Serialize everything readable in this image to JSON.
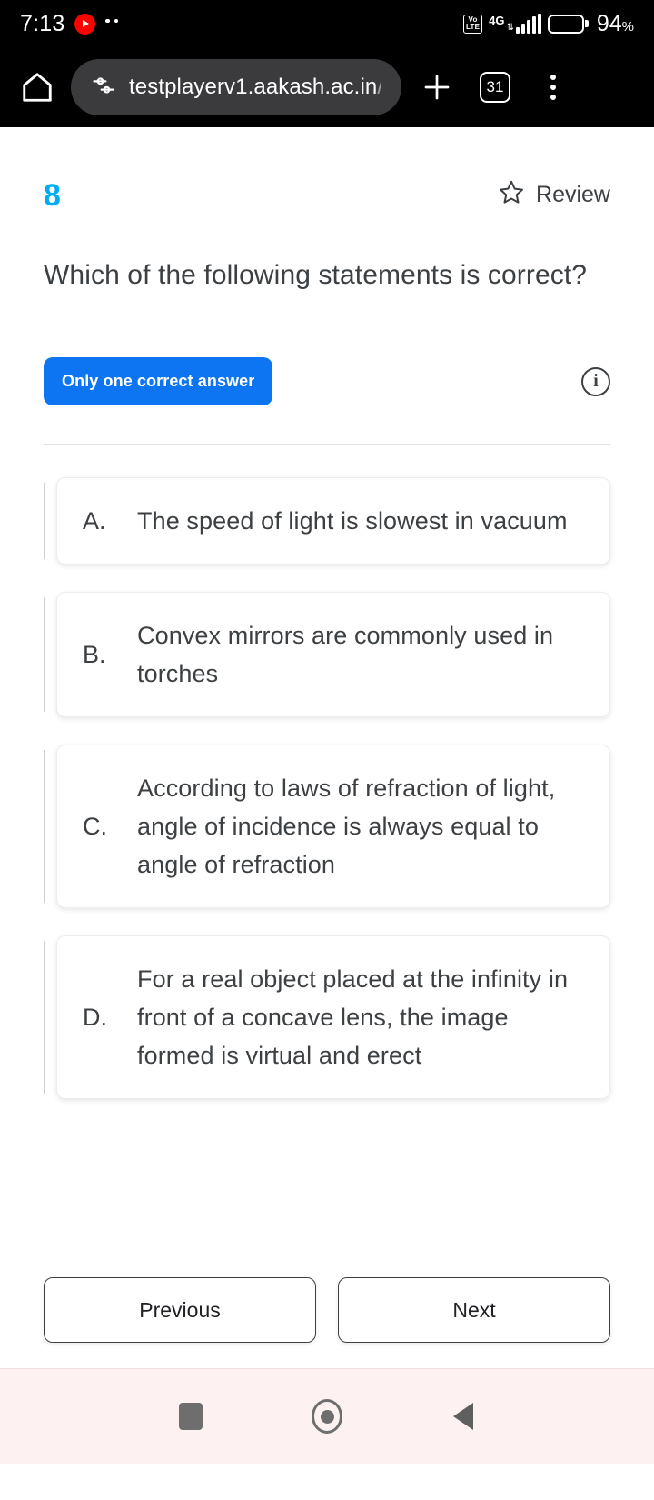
{
  "status_bar": {
    "time": "7:13",
    "youtube_icon": "youtube-icon",
    "extra_dots": "··",
    "volte_line1": "Vo",
    "volte_line2": "LTE",
    "network": "4G",
    "battery_percent": "94",
    "percent_symbol": "%"
  },
  "browser": {
    "home_icon": "home-icon",
    "site_settings_icon": "tune-icon",
    "url_visible": "testplayerv1.aakash.ac.in",
    "url_faded": "/t",
    "new_tab_icon": "plus-icon",
    "tab_count": "31",
    "menu_icon": "more-vertical-icon"
  },
  "question": {
    "number": "8",
    "review_label": "Review",
    "review_icon": "star-outline-icon",
    "text": "Which of the following statements is correct?",
    "badge_label": "Only one correct answer",
    "info_icon": "info-icon",
    "info_glyph": "i"
  },
  "options": [
    {
      "letter": "A.",
      "text": "The speed of light is slowest in vacuum"
    },
    {
      "letter": "B.",
      "text": "Convex mirrors are commonly used in torches"
    },
    {
      "letter": "C.",
      "text": "According to laws of refraction of light, angle of incidence is always equal to angle of refraction"
    },
    {
      "letter": "D.",
      "text": "For a real object placed at the infinity in front of a concave lens, the image formed is virtual and erect"
    }
  ],
  "navigation": {
    "previous_label": "Previous",
    "next_label": "Next"
  },
  "android_nav": {
    "recents_icon": "square-recents-icon",
    "home_icon": "circle-home-icon",
    "back_icon": "triangle-back-icon"
  },
  "colors": {
    "accent_blue": "#00AEEF",
    "badge_blue": "#0d75f2",
    "text_dark": "#3c4043",
    "nav_bar_bg": "#fdf1f1"
  }
}
